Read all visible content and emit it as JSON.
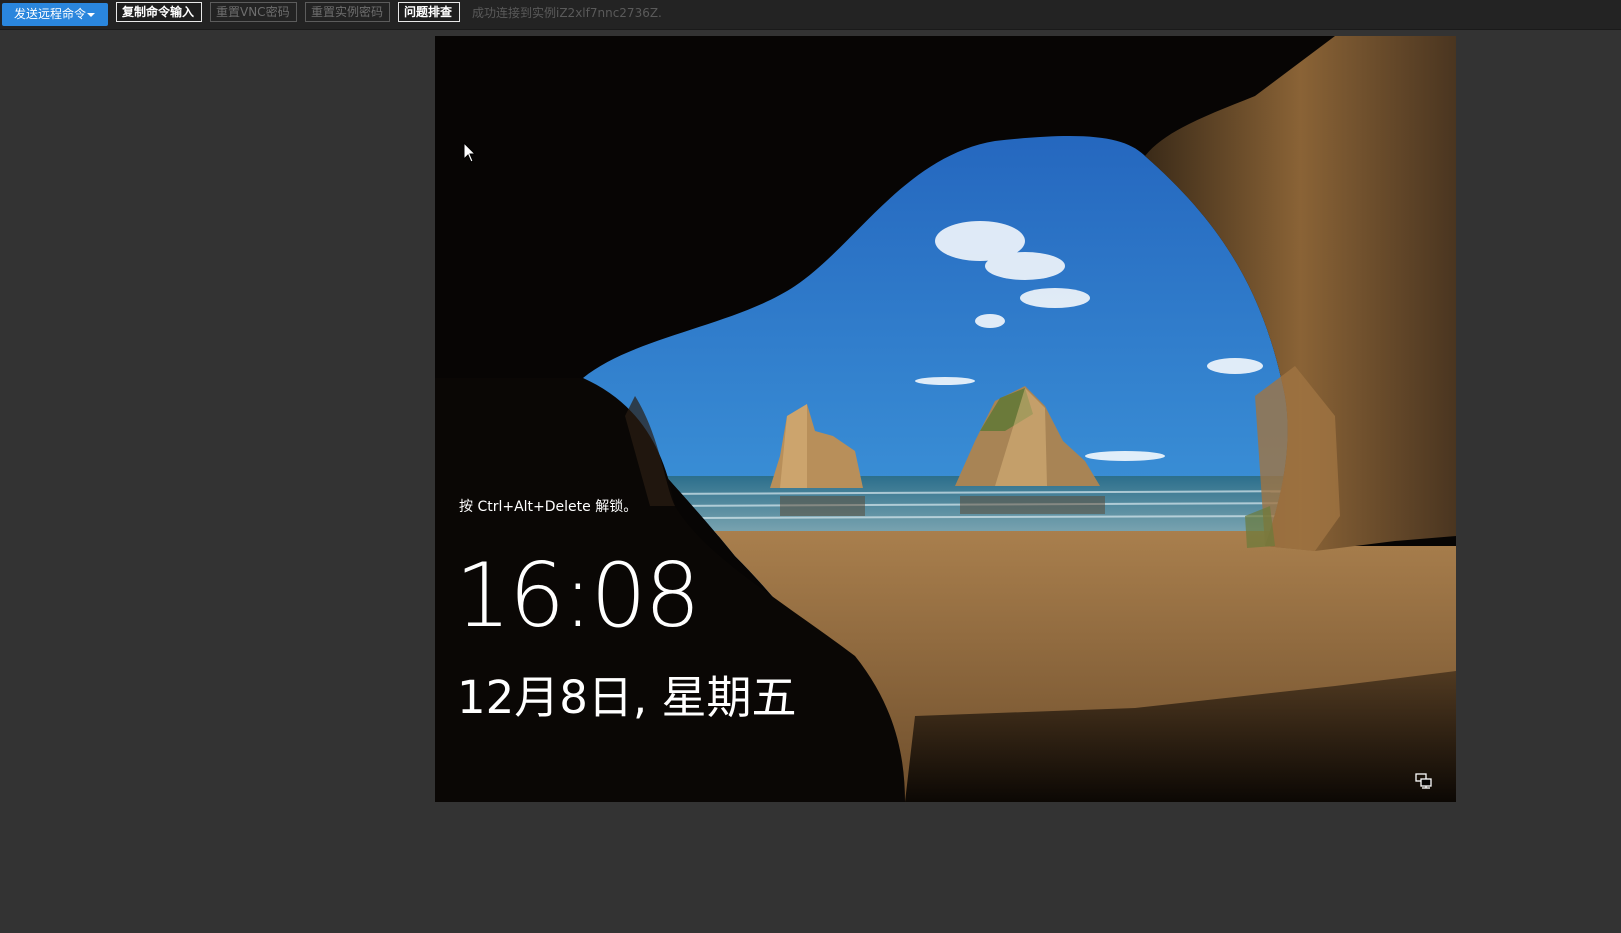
{
  "toolbar": {
    "send_remote_command": "发送远程命令",
    "copy_command_input": "复制命令输入",
    "reset_vnc_password": "重置VNC密码",
    "reset_instance_password": "重置实例密码",
    "troubleshoot": "问题排查",
    "status": "成功连接到实例iZ2xlf7nnc2736Z."
  },
  "lockscreen": {
    "unlock_hint": "按 Ctrl+Alt+Delete 解锁。",
    "time": "16:08",
    "date": "12月8日, 星期五",
    "network_icon": "network-icon"
  },
  "colors": {
    "accent": "#2a86dd",
    "toolbar_bg": "#232323",
    "page_bg": "#333333"
  }
}
